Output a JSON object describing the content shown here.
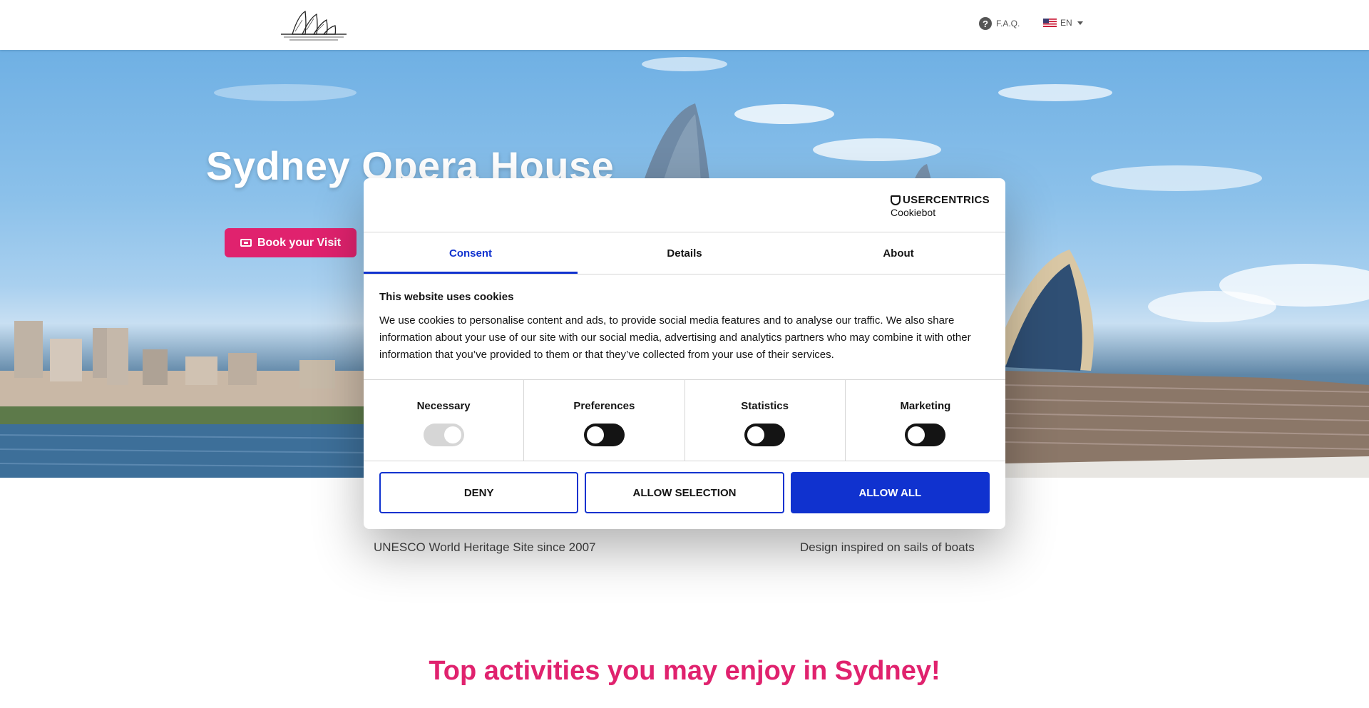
{
  "header": {
    "faq_label": "F.A.Q.",
    "language_label": "EN"
  },
  "hero": {
    "title": "Sydney Opera House",
    "book_label": "Book your Visit"
  },
  "features": {
    "left": "UNESCO World Heritage Site since 2007",
    "right": "Design inspired on sails of boats"
  },
  "section_title": "Top activities you may enjoy in Sydney!",
  "cookie": {
    "brand_top": "USERCENTRICS",
    "brand_bottom": "Cookiebot",
    "tabs": [
      "Consent",
      "Details",
      "About"
    ],
    "title": "This website uses cookies",
    "text": "We use cookies to personalise content and ads, to provide social media features and to analyse our traffic. We also share information about your use of our site with our social media, advertising and analytics partners who may combine it with other information that you’ve provided to them or that they’ve collected from your use of their services.",
    "categories": [
      "Necessary",
      "Preferences",
      "Statistics",
      "Marketing"
    ],
    "deny_label": "DENY",
    "allow_selection_label": "ALLOW SELECTION",
    "allow_all_label": "ALLOW ALL"
  },
  "colors": {
    "accent_pink": "#e0226e",
    "cookiebot_blue": "#1032cf"
  }
}
